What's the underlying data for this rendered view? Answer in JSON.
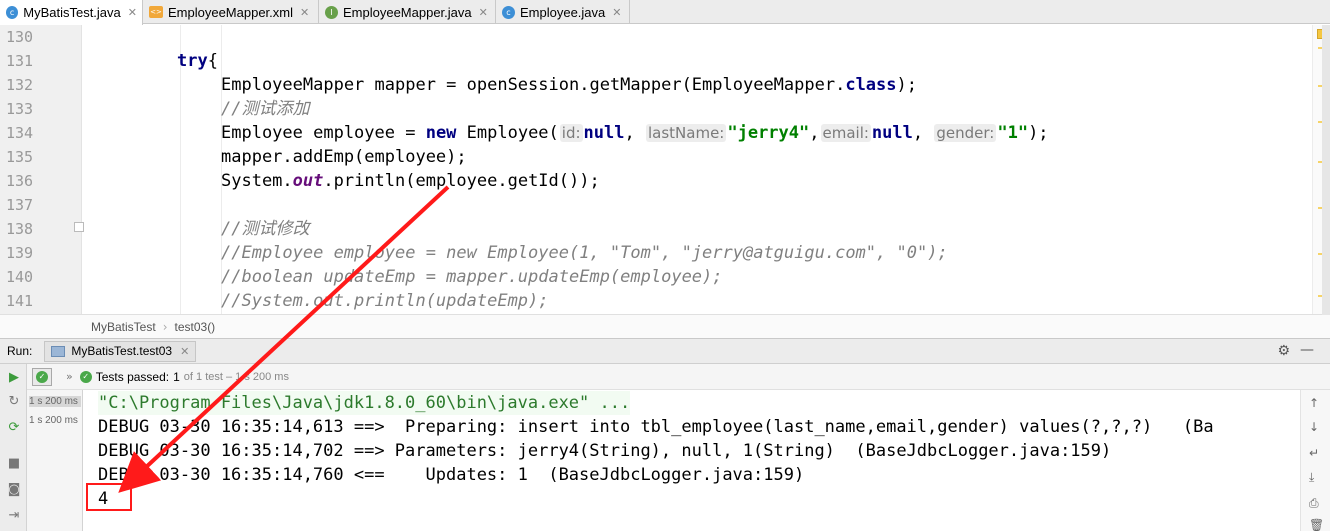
{
  "tabs": [
    {
      "label": "MyBatisTest.java",
      "icon": "class-icon",
      "active": true
    },
    {
      "label": "EmployeeMapper.xml",
      "icon": "xml-icon",
      "active": false
    },
    {
      "label": "EmployeeMapper.java",
      "icon": "interface-icon",
      "active": false
    },
    {
      "label": "Employee.java",
      "icon": "class-icon",
      "active": false
    }
  ],
  "editor": {
    "line_numbers": [
      "130",
      "131",
      "132",
      "133",
      "134",
      "135",
      "136",
      "137",
      "138",
      "139",
      "140",
      "141"
    ],
    "code": {
      "l131_kw": "try",
      "l131_rest": "{",
      "l132_a": "EmployeeMapper mapper = openSession.getMapper(EmployeeMapper.",
      "l132_kw": "class",
      "l132_b": ");",
      "l133": "//测试添加",
      "l134_a": "Employee employee = ",
      "l134_kw": "new",
      "l134_b": " Employee(",
      "l134_hint1": "id:",
      "l134_null1": "null",
      "l134_c1": ",",
      "l134_hint2": "lastName:",
      "l134_str1": "\"jerry4\"",
      "l134_c2": ",",
      "l134_hint3": "email:",
      "l134_null2": "null",
      "l134_c3": ",",
      "l134_hint4": "gender:",
      "l134_str2": "\"1\"",
      "l134_end": ");",
      "l135": "mapper.addEmp(employee);",
      "l136_a": "System.",
      "l136_fld": "out",
      "l136_b": ".println(employee.getId());",
      "l138": "//测试修改",
      "l139": "//Employee employee = new Employee(1, \"Tom\", \"jerry@atguigu.com\", \"0\");",
      "l140": "//boolean updateEmp = mapper.updateEmp(employee);",
      "l141": "//System.out.println(updateEmp);"
    }
  },
  "breadcrumb": {
    "class": "MyBatisTest",
    "method": "test03()"
  },
  "run_panel": {
    "label": "Run:",
    "tab": "MyBatisTest.test03",
    "status": {
      "prefix": "Tests passed:",
      "count": "1",
      "rest": "of 1 test – 1 s 200 ms"
    },
    "tree": [
      "1 s 200 ms",
      "1 s 200 ms"
    ],
    "console": [
      "\"C:\\Program Files\\Java\\jdk1.8.0_60\\bin\\java.exe\" ...",
      "DEBUG 03-30 16:35:14,613 ==>  Preparing: insert into tbl_employee(last_name,email,gender) values(?,?,?)   (Ba",
      "DEBUG 03-30 16:35:14,702 ==> Parameters: jerry4(String), null, 1(String)  (BaseJdbcLogger.java:159)",
      "DEBUG 03-30 16:35:14,760 <==    Updates: 1  (BaseJdbcLogger.java:159)",
      "4"
    ]
  },
  "colors": {
    "annotation": "#ff1a1a",
    "keyword": "#000080",
    "string": "#008000",
    "comment": "#808080"
  }
}
